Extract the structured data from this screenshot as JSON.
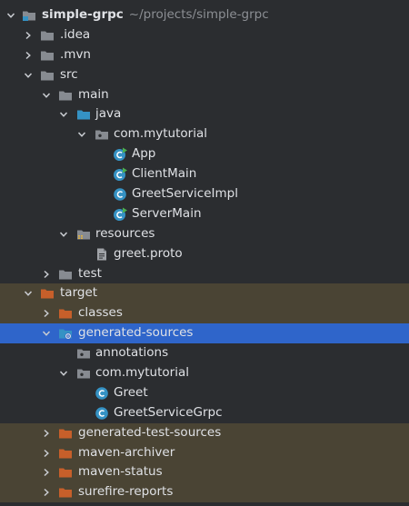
{
  "tree": [
    {
      "label": "simple-grpc",
      "hint": "~/projects/simple-grpc",
      "icon": "module-folder-icon",
      "expanded": true
    },
    {
      "label": ".idea",
      "icon": "folder-icon",
      "expanded": false
    },
    {
      "label": ".mvn",
      "icon": "folder-icon",
      "expanded": false
    },
    {
      "label": "src",
      "icon": "folder-icon",
      "expanded": true
    },
    {
      "label": "main",
      "icon": "folder-icon",
      "expanded": true
    },
    {
      "label": "java",
      "icon": "source-root-folder-icon",
      "expanded": true
    },
    {
      "label": "com.mytutorial",
      "icon": "package-icon",
      "expanded": true
    },
    {
      "label": "App",
      "icon": "runnable-class-icon"
    },
    {
      "label": "ClientMain",
      "icon": "runnable-class-icon"
    },
    {
      "label": "GreetServiceImpl",
      "icon": "class-icon"
    },
    {
      "label": "ServerMain",
      "icon": "runnable-class-icon"
    },
    {
      "label": "resources",
      "icon": "resources-folder-icon",
      "expanded": true
    },
    {
      "label": "greet.proto",
      "icon": "file-icon"
    },
    {
      "label": "test",
      "icon": "folder-icon",
      "expanded": false
    },
    {
      "label": "target",
      "icon": "excluded-folder-icon",
      "expanded": true
    },
    {
      "label": "classes",
      "icon": "excluded-folder-icon",
      "expanded": false
    },
    {
      "label": "generated-sources",
      "icon": "generated-sources-folder-icon",
      "expanded": true
    },
    {
      "label": "annotations",
      "icon": "package-icon"
    },
    {
      "label": "com.mytutorial",
      "icon": "package-icon",
      "expanded": true
    },
    {
      "label": "Greet",
      "icon": "class-icon"
    },
    {
      "label": "GreetServiceGrpc",
      "icon": "class-icon"
    },
    {
      "label": "generated-test-sources",
      "icon": "excluded-folder-icon",
      "expanded": false
    },
    {
      "label": "maven-archiver",
      "icon": "excluded-folder-icon",
      "expanded": false
    },
    {
      "label": "maven-status",
      "icon": "excluded-folder-icon",
      "expanded": false
    },
    {
      "label": "surefire-reports",
      "icon": "excluded-folder-icon",
      "expanded": false
    }
  ],
  "colors": {
    "background": "#2b2d30",
    "excluded_row": "#4a4434",
    "selected_row": "#2f65ca",
    "text": "#dfe1e5",
    "hint": "#8c8f94",
    "folder": "#878b91",
    "source_folder": "#3592c4",
    "excluded_folder": "#c75f2a",
    "class_icon": "#3592c4"
  }
}
